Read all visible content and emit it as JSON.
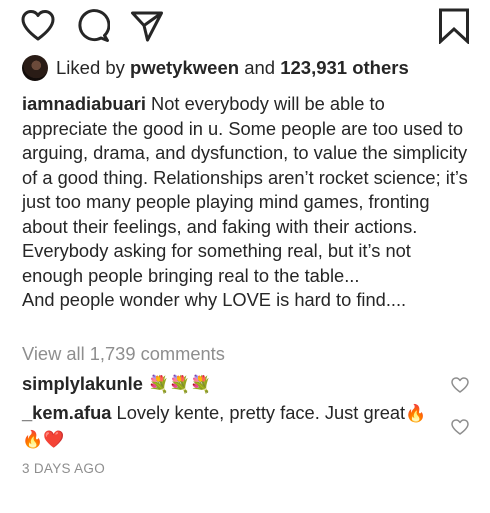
{
  "post": {
    "liked_by_prefix": "Liked by",
    "liked_by_user": "pwetykween",
    "liked_by_and": "and",
    "liked_by_others": "123,931 others",
    "caption_user": "iamnadiabuari",
    "caption_text": "Not everybody will be able to appreciate the good in u. Some people are too used to arguing, drama, and dysfunction, to value the simplicity of a good thing. Relationships aren’t rocket science; it’s just too many people playing mind games, fronting about their feelings, and faking with their actions. Everybody asking for something real, but it’s not enough people bringing real to the table...\nAnd people wonder why LOVE is hard to find....",
    "view_all_comments": "View all 1,739 comments",
    "timestamp": "3 DAYS AGO"
  },
  "comments": [
    {
      "user": "simplylakunle",
      "text": "",
      "emojis": "💐💐💐"
    },
    {
      "user": "_kem.afua",
      "text": "Lovely kente, pretty face. Just great",
      "emoji_inline": "🔥",
      "emojis_after": "🔥❤️"
    }
  ],
  "icons": {
    "like": "heart-outline-icon",
    "comment": "speech-bubble-icon",
    "share": "paper-plane-icon",
    "save": "bookmark-icon",
    "comment_like": "small-heart-outline-icon"
  },
  "colors": {
    "text": "#262626",
    "muted": "#8e8e8e",
    "background": "#ffffff"
  }
}
